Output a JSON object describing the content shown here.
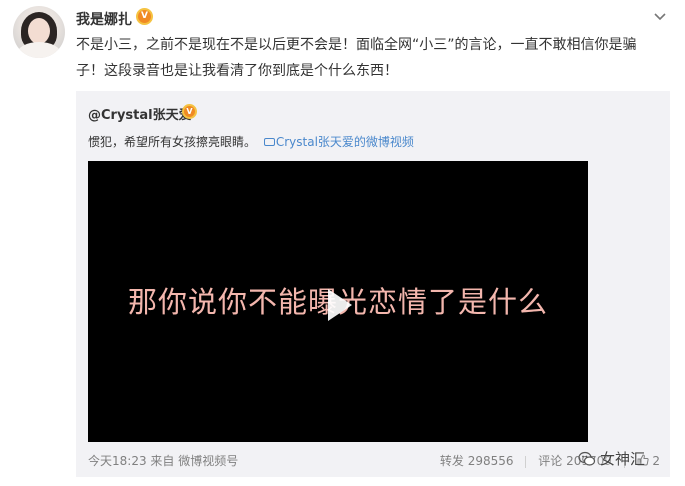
{
  "post": {
    "username": "我是娜扎",
    "verified_badge": "V",
    "text": "不是小三，之前不是现在不是以后更不会是！面临全网“小三”的言论，一直不敢相信你是骗子！这段录音也是让我看清了你到底是个什么东西！"
  },
  "repost": {
    "author": "@Crystal张天爱",
    "verified_badge": "V",
    "text": "惯犯，希望所有女孩擦亮眼睛。",
    "video_link": "Crystal张天爱的微博视频",
    "video_subtitle": "那你说你不能曝光恋情了是什么",
    "meta": {
      "time": "今天18:23",
      "source": "来自 微博视频号"
    },
    "stats": {
      "repost_label": "转发",
      "repost_count": "298556",
      "comment_label": "评论",
      "comment_count": "209709",
      "like_count_partial": "2"
    }
  },
  "watermark": {
    "text": "女神汇"
  },
  "icons": {
    "menu": "chevron-down-icon",
    "play": "play-icon",
    "video_link": "video-icon",
    "like": "thumbs-up-icon",
    "watermark": "wechat-icon"
  },
  "colors": {
    "badge": "#f08a24",
    "link": "#4a88cc",
    "repost_bg": "#f2f2f5",
    "subtitle": "#f3b6ad"
  }
}
